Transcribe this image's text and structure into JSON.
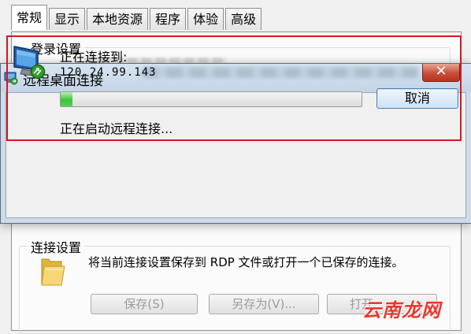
{
  "tabs": [
    {
      "label": "常规",
      "active": true
    },
    {
      "label": "显示",
      "active": false
    },
    {
      "label": "本地资源",
      "active": false
    },
    {
      "label": "程序",
      "active": false
    },
    {
      "label": "体验",
      "active": false
    },
    {
      "label": "高级",
      "active": false
    }
  ],
  "login_group": {
    "label": "登录设置"
  },
  "connection_group": {
    "label": "连接设置",
    "description": "将当前连接设置保存到 RDP 文件或打开一个已保存的连接。",
    "save_button": "保存(S)",
    "save_as_button": "另存为(V)...",
    "open_button": "打开"
  },
  "dialog": {
    "title": "远程桌面连接",
    "close_label": "✕",
    "connecting_label": "正在连接到:",
    "address": "120.24.99.143",
    "progress_percent": 4,
    "cancel_button": "取消",
    "status": "正在启动远程连接..."
  },
  "watermark": "云南龙网",
  "colors": {
    "highlight_border": "#d7161f",
    "progress_green": "#3fc33a",
    "close_red": "#c74d36"
  }
}
